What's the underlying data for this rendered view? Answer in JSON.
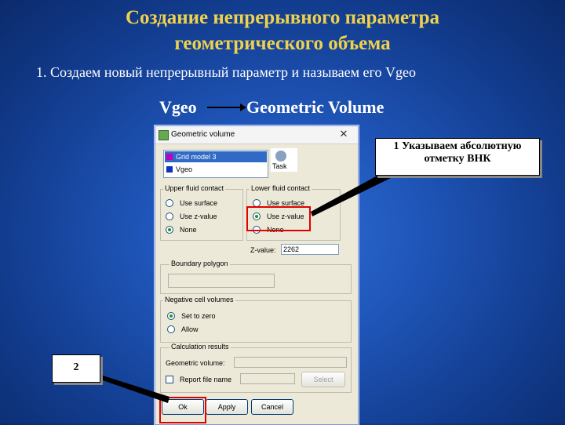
{
  "slide": {
    "title_line1": "Создание непрерывного параметра",
    "title_line2": "геометрического объема",
    "step1": "1. Создаем новый непрерывный параметр и называем его Vgeo",
    "vgeo": "Vgeo",
    "geometric_volume": "Geometric Volume",
    "callout1": "1 Указываем абсолютную отметку ВНК",
    "callout2": "2"
  },
  "dialog": {
    "title": "Geometric volume",
    "close_glyph": "✕",
    "list_items": [
      {
        "label": "Grid model 3",
        "color": "#c000c0"
      },
      {
        "label": "Vgeo",
        "color": "#1030c0"
      }
    ],
    "task_label": "Task",
    "upper": {
      "title": "Upper fluid contact",
      "options": [
        "Use surface",
        "Use z-value",
        "None"
      ]
    },
    "lower": {
      "title": "Lower fluid contact",
      "options": [
        "Use surface",
        "Use z-value",
        "None"
      ],
      "zvalue_label": "Z-value:",
      "zvalue": "2262"
    },
    "boundary": {
      "title": "Boundary polygon"
    },
    "negative": {
      "title": "Negative cell volumes",
      "options": [
        "Set to zero",
        "Allow"
      ]
    },
    "calc": {
      "title": "Calculation results",
      "geom_volume_label": "Geometric volume:",
      "report_label": "Report file name",
      "select_button": "Select"
    },
    "buttons": {
      "ok": "Ok",
      "apply": "Apply",
      "cancel": "Cancel"
    }
  },
  "colors": {
    "title": "#f0d24a",
    "highlight": "#e00000",
    "selection": "#316ac5"
  }
}
